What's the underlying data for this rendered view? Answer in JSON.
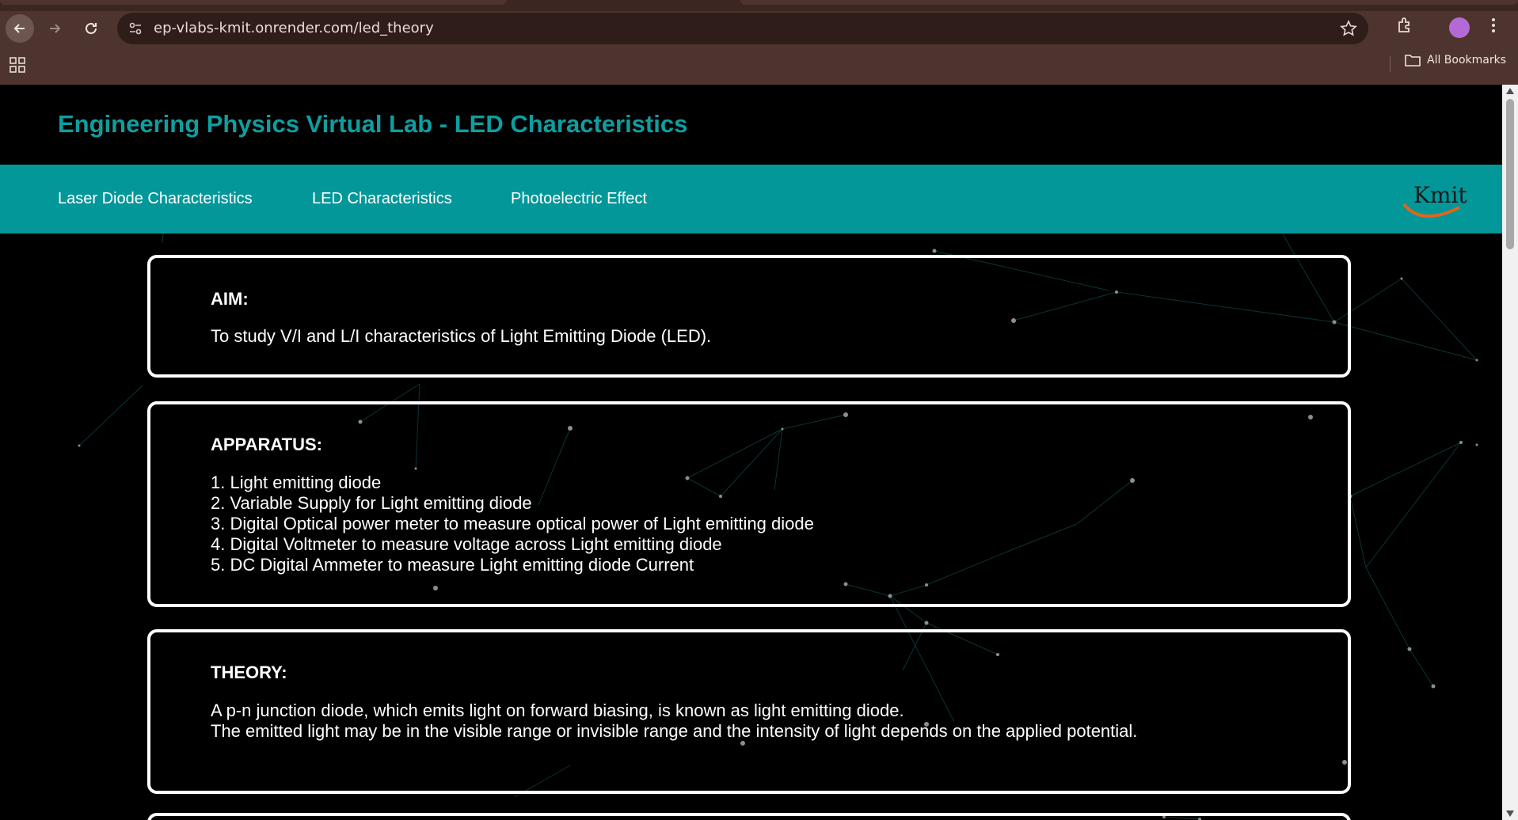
{
  "browser": {
    "url": "ep-vlabs-kmit.onrender.com/led_theory",
    "bookmarks_label": "All Bookmarks"
  },
  "site": {
    "title": "Engineering Physics Virtual Lab - LED Characteristics",
    "nav": [
      "Laser Diode Characteristics",
      "LED Characteristics",
      "Photoelectric Effect"
    ],
    "logo_text": "Kmit",
    "accent_color": "#039799",
    "title_color": "#0f9ea0"
  },
  "aim": {
    "heading": "AIM:",
    "text": "To study V/I and L/I characteristics of Light Emitting Diode (LED)."
  },
  "apparatus": {
    "heading": "APPARATUS:",
    "items": [
      "1. Light emitting diode",
      "2. Variable Supply for Light emitting diode",
      "3. Digital Optical power meter to measure optical power of Light emitting diode",
      "4. Digital Voltmeter to measure voltage across Light emitting diode",
      "5. DC Digital Ammeter to measure Light emitting diode Current"
    ]
  },
  "theory": {
    "heading": "THEORY:",
    "lines": [
      "A p-n junction diode, which emits light on forward biasing, is known as light emitting diode.",
      "The emitted light may be in the visible range or invisible range and the intensity of light depends on the applied potential."
    ]
  }
}
